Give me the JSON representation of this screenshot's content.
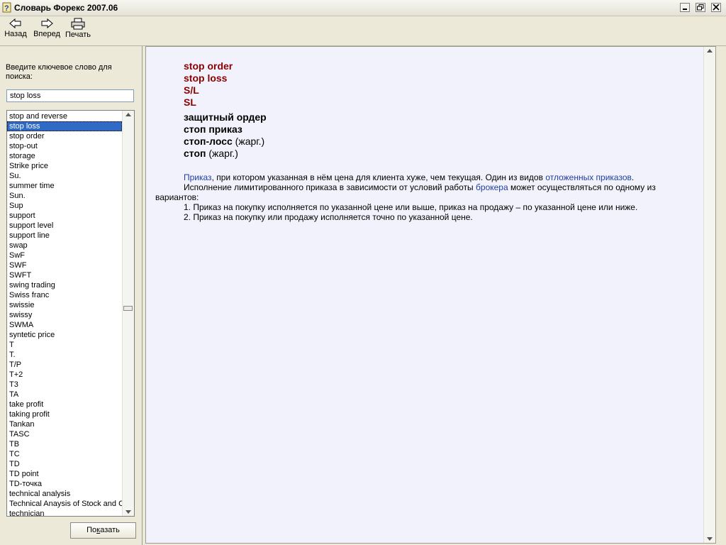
{
  "window": {
    "title": "Словарь Форекс 2007.06"
  },
  "toolbar": {
    "back": "Назад",
    "forward": "Вперед",
    "print": "Печать"
  },
  "search": {
    "prompt": "Введите ключевое слово для поиска:",
    "value": "stop loss"
  },
  "list": {
    "items": [
      "stop and reverse",
      "stop loss",
      "stop order",
      "stop-out",
      "storage",
      "Strike price",
      "Su.",
      "summer time",
      "Sun.",
      "Sup",
      "support",
      "support level",
      "support line",
      "swap",
      "SwF",
      "SWF",
      "SWFT",
      "swing trading",
      "Swiss franc",
      "swissie",
      "swissy",
      "SWMA",
      "syntetic price",
      "T",
      "T.",
      "T/P",
      "T+2",
      "T3",
      "TA",
      "take profit",
      "taking profit",
      "Tankan",
      "TASC",
      "TB",
      "TC",
      "TD",
      "TD point",
      "TD-точка",
      "technical analysis",
      "Technical Anaysis of Stock and Commodities",
      "technician"
    ],
    "selected_index": 1
  },
  "show_button": {
    "pre": "По",
    "accel": "к",
    "post": "азать"
  },
  "entry": {
    "terms": [
      "stop order",
      "stop loss",
      "S/L",
      "SL"
    ],
    "translations": [
      {
        "word": "защитный ордер",
        "note": ""
      },
      {
        "word": "стоп приказ",
        "note": ""
      },
      {
        "word": "стоп-лосс",
        "note": " (жарг.)"
      },
      {
        "word": "стоп",
        "note": " (жарг.)"
      }
    ],
    "p1_link1": "Приказ",
    "p1_text": ", при котором указанная в нём цена для клиента хуже, чем текущая. Один из видов ",
    "p1_link2": "отложенных приказов",
    "p1_end": ".",
    "p2_text": "Исполнение лимитированного приказа в зависимости от условий работы ",
    "p2_link": "брокера",
    "p2_end": " может осуществляться по одному из вариантов:",
    "option1": "1. Приказ на покупку исполняется по указанной цене или выше, приказ на продажу – по указанной цене или ниже.",
    "option2": "2. Приказ на покупку или продажу исполняется точно по указанной цене."
  },
  "colors": {
    "term": "#8b0000",
    "link": "#1f3fa0",
    "selection": "#316ac5",
    "content_bg": "#f2f2fc"
  }
}
